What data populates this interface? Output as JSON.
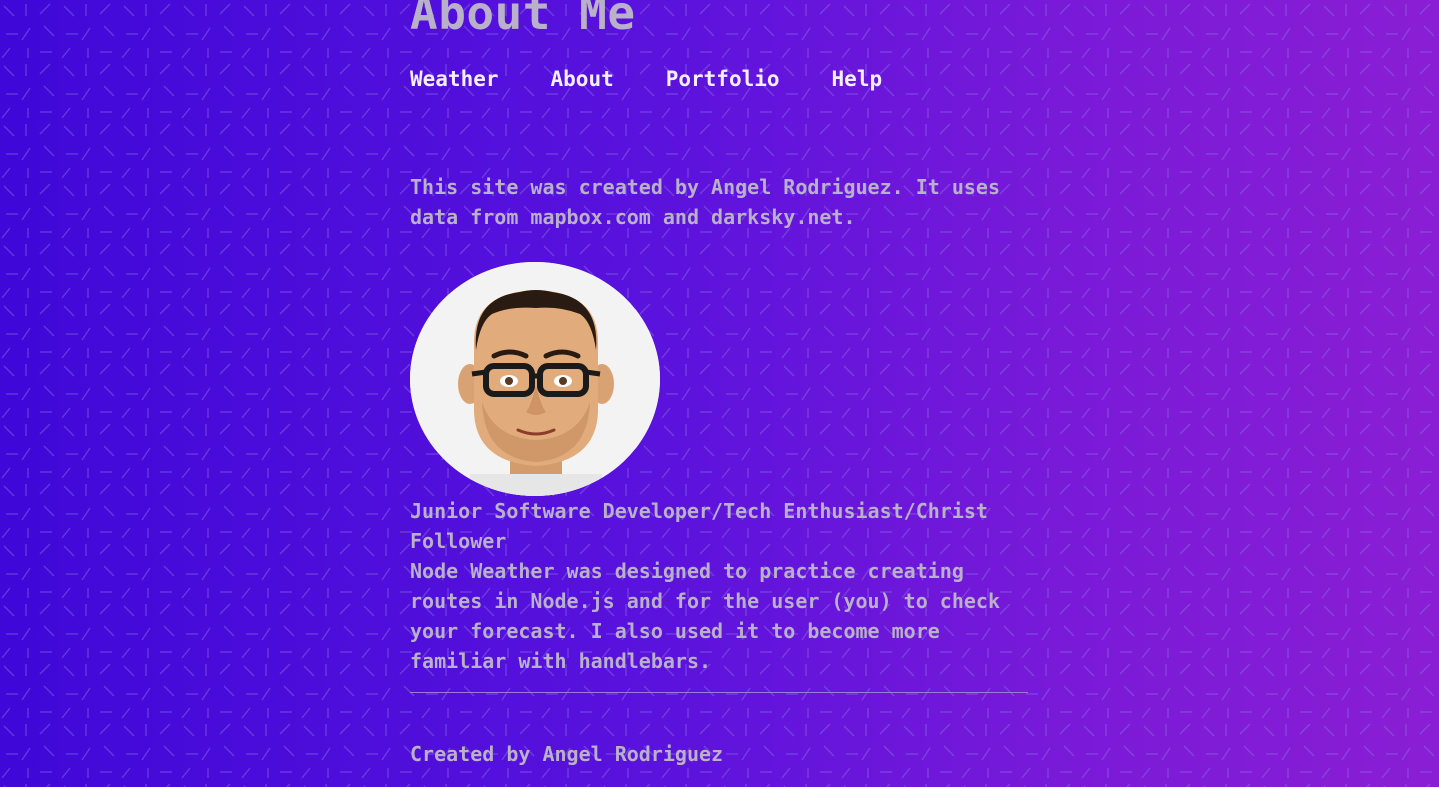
{
  "page": {
    "title": "About Me"
  },
  "nav": {
    "items": [
      {
        "label": "Weather"
      },
      {
        "label": "About"
      },
      {
        "label": "Portfolio"
      },
      {
        "label": "Help"
      }
    ]
  },
  "content": {
    "intro": "This site was created by Angel Rodriguez. It uses data from mapbox.com and darksky.net.",
    "tagline": "Junior Software Developer/Tech Enthusiast/Christ Follower",
    "about": "Node Weather was designed to practice creating routes in Node.js and for the user (you) to check your forecast. I also used it to become more familiar with handlebars."
  },
  "footer": {
    "text": "Created by Angel Rodriguez"
  },
  "images": {
    "avatar": "cartoon-avatar-man-with-glasses"
  },
  "colors": {
    "background_start": "#3f08d8",
    "background_end": "#8a1ed4",
    "text": "#b9b0c9",
    "nav_text": "#f2eefa"
  }
}
